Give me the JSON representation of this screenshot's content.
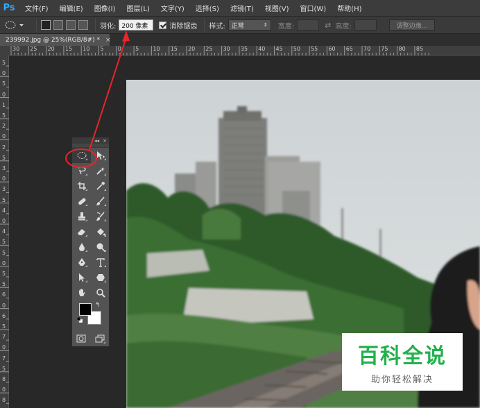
{
  "app": {
    "logo": "Ps",
    "menu": [
      "文件(F)",
      "编辑(E)",
      "图像(I)",
      "图层(L)",
      "文字(Y)",
      "选择(S)",
      "滤镜(T)",
      "视图(V)",
      "窗口(W)",
      "帮助(H)"
    ]
  },
  "options": {
    "feather_label": "羽化:",
    "feather_value": "200 像素",
    "antialias_label": "消除锯齿",
    "style_label": "样式:",
    "style_value": "正常",
    "width_label": "宽度:",
    "height_label": "高度:",
    "refine_edge_label": "调整边缘..."
  },
  "document": {
    "tab_title": "239992.jpg @ 25%(RGB/8#) *",
    "close_glyph": "×"
  },
  "rulers": {
    "top_labels": [
      "30",
      "25",
      "20",
      "15",
      "10",
      "5",
      "0",
      "5",
      "10",
      "15",
      "20",
      "25",
      "30",
      "35",
      "40",
      "45",
      "50",
      "55",
      "60",
      "65",
      "70",
      "75",
      "80",
      "85"
    ],
    "left_labels": [
      "5",
      "0",
      "5",
      "0",
      "1",
      "5",
      "2",
      "0",
      "2",
      "5",
      "3",
      "0",
      "3",
      "5",
      "4",
      "0",
      "4",
      "5",
      "5",
      "0",
      "5",
      "5",
      "6",
      "0",
      "6",
      "5",
      "7",
      "0",
      "7",
      "5",
      "8",
      "0",
      "8"
    ]
  },
  "tools_panel": {
    "collapse_glyph": "◂◂",
    "close_glyph": "×",
    "swap_glyph": "↰"
  },
  "colors": {
    "foreground": "#000000",
    "background": "#ffffff",
    "annotation": "#e8262a",
    "watermark_green": "#22b14c"
  },
  "watermark": {
    "title": "百科全说",
    "subtitle": "助你轻松解决"
  }
}
